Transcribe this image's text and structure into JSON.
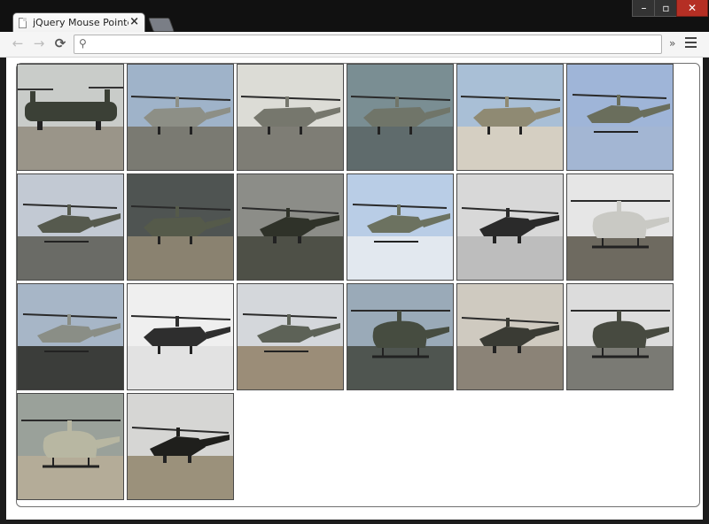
{
  "window": {
    "tab_title": "jQuery Mouse Pointer Pro",
    "tab_close": "×",
    "min": "–",
    "max": "▫",
    "close": "✕"
  },
  "toolbar": {
    "back": "←",
    "forward": "→",
    "reload": "⟳",
    "search_glyph": "⚲",
    "url_value": "",
    "overflow": "»"
  },
  "gallery": {
    "images": [
      {
        "subject": "chinook-helicopter",
        "sky": "#c9ccc9",
        "ground": "#9a9589",
        "body": "#3b4036",
        "style": "tandem"
      },
      {
        "subject": "mi24-helicopter",
        "sky": "#9fb3c9",
        "ground": "#7a7a72",
        "body": "#8d8f86",
        "style": "attack"
      },
      {
        "subject": "mi24-helicopter",
        "sky": "#dcdcd6",
        "ground": "#7e7d75",
        "body": "#76776d",
        "style": "attack"
      },
      {
        "subject": "mi24-helicopter",
        "sky": "#7a8e93",
        "ground": "#5f6b6c",
        "body": "#707569",
        "style": "attack"
      },
      {
        "subject": "mi24-helicopter",
        "sky": "#a9bfd6",
        "ground": "#d5cfc2",
        "body": "#8f8a73",
        "style": "attack"
      },
      {
        "subject": "cobra-helicopter",
        "sky": "#9fb5d8",
        "ground": "#a3b6d3",
        "body": "#6a6e5c",
        "style": "cobra"
      },
      {
        "subject": "cobra-helicopter",
        "sky": "#c2c9d3",
        "ground": "#6a6b66",
        "body": "#565a4e",
        "style": "cobra"
      },
      {
        "subject": "mi24-helicopter",
        "sky": "#4f5452",
        "ground": "#8a8270",
        "body": "#555a4a",
        "style": "attack"
      },
      {
        "subject": "apache-helicopter",
        "sky": "#8c8d88",
        "ground": "#4e5047",
        "body": "#2f3229",
        "style": "apache"
      },
      {
        "subject": "cobra-helicopter",
        "sky": "#b9cde6",
        "ground": "#e2e8ef",
        "body": "#6c7260",
        "style": "cobra"
      },
      {
        "subject": "apache-helicopter",
        "sky": "#d8d8d8",
        "ground": "#bdbdbd",
        "body": "#2a2a2a",
        "style": "apache"
      },
      {
        "subject": "huey-helicopter",
        "sky": "#e6e6e6",
        "ground": "#6e6a60",
        "body": "#c9c9c4",
        "style": "utility"
      },
      {
        "subject": "cobra-helicopter",
        "sky": "#a7b6c7",
        "ground": "#3b3d3a",
        "body": "#8a8e86",
        "style": "cobra"
      },
      {
        "subject": "mi24-helicopter",
        "sky": "#efefef",
        "ground": "#e2e2e2",
        "body": "#2e2e2e",
        "style": "attack"
      },
      {
        "subject": "cobra-helicopter",
        "sky": "#d4d7db",
        "ground": "#9b8d78",
        "body": "#5d6257",
        "style": "cobra"
      },
      {
        "subject": "huey-helicopter",
        "sky": "#9aaab8",
        "ground": "#4f5550",
        "body": "#464c40",
        "style": "utility"
      },
      {
        "subject": "apache-helicopter",
        "sky": "#cfcac0",
        "ground": "#8b8377",
        "body": "#3a3b34",
        "style": "apache"
      },
      {
        "subject": "huey-helicopter",
        "sky": "#dcdcdc",
        "ground": "#7a7a74",
        "body": "#474a40",
        "style": "utility"
      },
      {
        "subject": "bell-helicopter",
        "sky": "#9aa19a",
        "ground": "#b4ac98",
        "body": "#b8b7a2",
        "style": "utility"
      },
      {
        "subject": "blackhawk-helicopter",
        "sky": "#d6d6d4",
        "ground": "#9b917b",
        "body": "#1f1f1c",
        "style": "apache"
      }
    ]
  }
}
